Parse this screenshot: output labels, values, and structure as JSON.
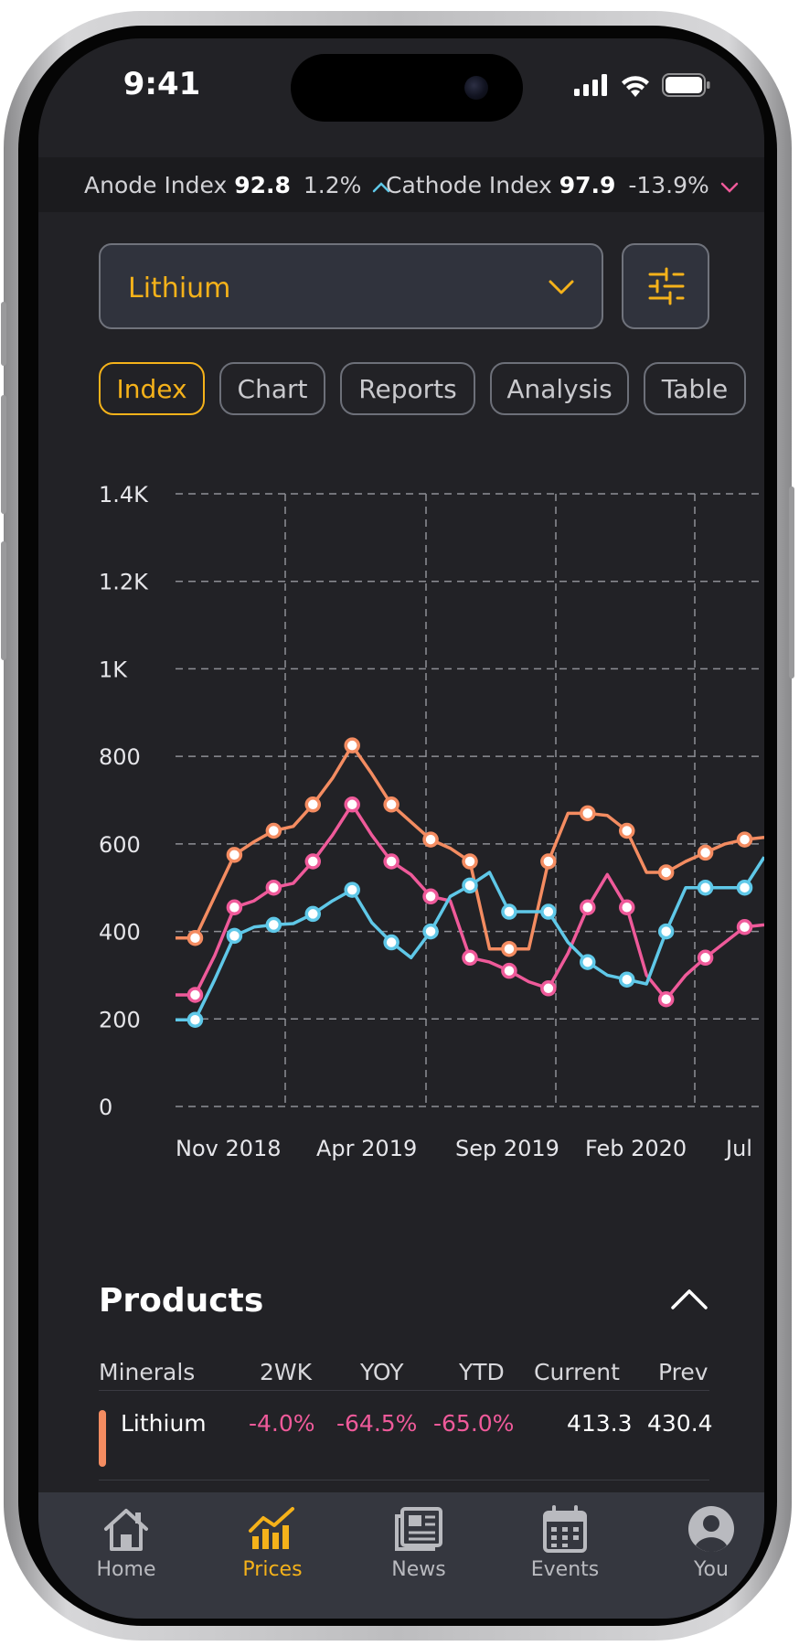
{
  "status": {
    "time": "9:41"
  },
  "ticker": {
    "anode_label": "Anode Index",
    "anode_value": "92.8",
    "anode_change": "1.2%",
    "cathode_label": "Cathode Index",
    "cathode_value": "97.9",
    "cathode_change": "-13.9%",
    "up_color": "#5fc8e8",
    "down_color": "#ef5a9a"
  },
  "selector": {
    "value": "Lithium"
  },
  "tabs": [
    {
      "label": "Index",
      "active": true
    },
    {
      "label": "Chart",
      "active": false
    },
    {
      "label": "Reports",
      "active": false
    },
    {
      "label": "Analysis",
      "active": false
    },
    {
      "label": "Table",
      "active": false
    }
  ],
  "chart_data": {
    "type": "line",
    "y_ticks": [
      "1.4K",
      "1.2K",
      "1K",
      "800",
      "600",
      "400",
      "200",
      "0"
    ],
    "ylim": [
      0,
      1400
    ],
    "x_ticks": [
      "Nov 2018",
      "Apr 2019",
      "Sep 2019",
      "Feb 2020",
      "Jul"
    ],
    "grid": true,
    "series": [
      {
        "color": "#f48c61",
        "values": [
          385,
          385,
          480,
          575,
          605,
          630,
          640,
          690,
          750,
          825,
          760,
          690,
          650,
          610,
          590,
          560,
          360,
          360,
          360,
          560,
          670,
          670,
          665,
          630,
          535,
          535,
          560,
          580,
          600,
          610,
          615
        ]
      },
      {
        "color": "#ef5a9a",
        "values": [
          255,
          255,
          345,
          455,
          470,
          500,
          510,
          560,
          620,
          690,
          620,
          560,
          530,
          480,
          470,
          340,
          330,
          310,
          285,
          270,
          350,
          455,
          530,
          455,
          300,
          245,
          300,
          340,
          375,
          410,
          415
        ]
      },
      {
        "color": "#5fc8e8",
        "values": [
          198,
          198,
          290,
          390,
          410,
          415,
          418,
          440,
          470,
          495,
          420,
          375,
          340,
          400,
          480,
          505,
          535,
          445,
          445,
          445,
          375,
          330,
          300,
          290,
          280,
          400,
          500,
          500,
          500,
          500,
          570
        ]
      }
    ]
  },
  "products": {
    "title": "Products",
    "headers": [
      "Minerals",
      "2WK",
      "YOY",
      "YTD",
      "Current",
      "Prev"
    ],
    "rows": [
      {
        "mineral": "Lithium",
        "two_wk": "-4.0%",
        "yoy": "-64.5%",
        "ytd": "-65.0%",
        "current": "413.3",
        "prev": "430.4",
        "accent_color": "#f48c61"
      }
    ]
  },
  "nav": [
    {
      "label": "Home",
      "icon": "home-icon",
      "active": false
    },
    {
      "label": "Prices",
      "icon": "chart-icon",
      "active": true
    },
    {
      "label": "News",
      "icon": "newspaper-icon",
      "active": false
    },
    {
      "label": "Events",
      "icon": "calendar-icon",
      "active": false
    },
    {
      "label": "You",
      "icon": "user-icon",
      "active": false
    }
  ],
  "colors": {
    "accent": "#f5b21a",
    "background": "#222226",
    "negative": "#ef5a9a"
  }
}
